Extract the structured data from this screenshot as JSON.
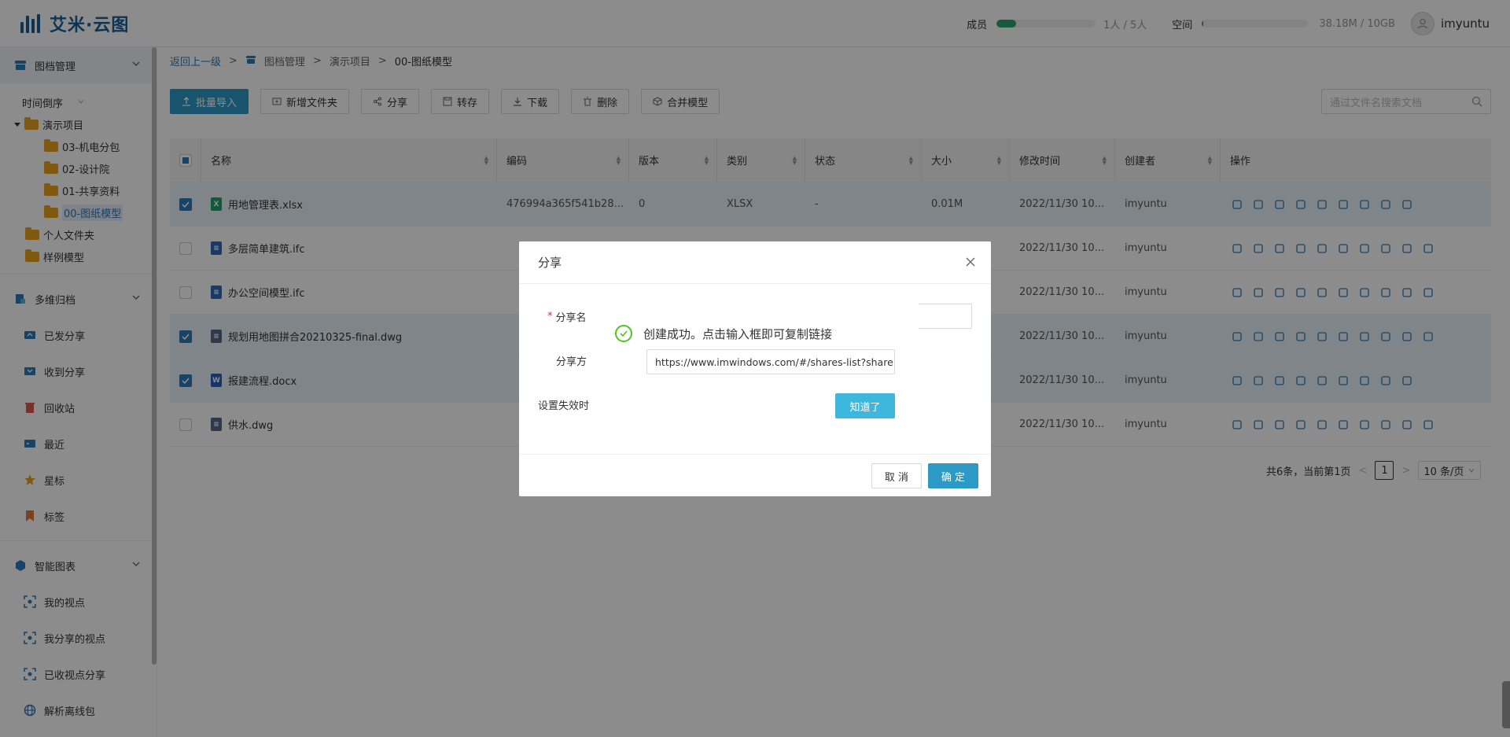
{
  "app": {
    "logo_text": "艾米·云图"
  },
  "header": {
    "members_label": "成员",
    "members_value": "1人 / 5人",
    "members_fraction": 0.2,
    "space_label": "空间",
    "space_value": "38.18M / 10GB",
    "space_fraction": 0.004,
    "username": "imyuntu"
  },
  "sidebar": {
    "section1": "图档管理",
    "sort_label": "时间倒序",
    "tree": [
      {
        "label": "演示项目"
      },
      {
        "label": "03-机电分包"
      },
      {
        "label": "02-设计院"
      },
      {
        "label": "01-共享资料"
      },
      {
        "label": "00-图纸模型"
      },
      {
        "label": "个人文件夹"
      },
      {
        "label": "样例模型"
      }
    ],
    "section2": "多维归档",
    "nav2": [
      {
        "label": "已发分享"
      },
      {
        "label": "收到分享"
      },
      {
        "label": "回收站"
      },
      {
        "label": "最近"
      },
      {
        "label": "星标"
      },
      {
        "label": "标签"
      }
    ],
    "section3": "智能图表",
    "nav3": [
      {
        "label": "我的视点"
      },
      {
        "label": "我分享的视点"
      },
      {
        "label": "已收视点分享"
      },
      {
        "label": "解析离线包"
      }
    ]
  },
  "breadcrumb": {
    "back": "返回上一级",
    "sep": ">",
    "root": "图档管理",
    "project": "演示项目",
    "current": "00-图纸模型"
  },
  "toolbar": {
    "import": "批量导入",
    "new_folder": "新增文件夹",
    "share": "分享",
    "transfer": "转存",
    "download": "下载",
    "delete": "删除",
    "merge": "合并模型",
    "search_placeholder": "通过文件名搜索文档"
  },
  "table": {
    "headers": [
      "名称",
      "编码",
      "版本",
      "类别",
      "状态",
      "大小",
      "修改时间",
      "创建者",
      "操作"
    ],
    "rows": [
      {
        "name": "用地管理表.xlsx",
        "code": "476994a365f541b28...",
        "version": "0",
        "type": "XLSX",
        "status": "-",
        "size": "0.01M",
        "time": "2022/11/30 10...",
        "creator": "imyuntu"
      },
      {
        "name": "多层简单建筑.ifc",
        "code": "",
        "version": "",
        "type": "",
        "status": "",
        "size": "",
        "time": "2022/11/30 10...",
        "creator": "imyuntu"
      },
      {
        "name": "办公空间模型.ifc",
        "code": "",
        "version": "",
        "type": "",
        "status": "",
        "size": "",
        "time": "2022/11/30 10...",
        "creator": "imyuntu"
      },
      {
        "name": "规划用地图拼合20210325-final.dwg",
        "code": "",
        "version": "",
        "type": "",
        "status": "",
        "size": "",
        "time": "2022/11/30 10...",
        "creator": "imyuntu"
      },
      {
        "name": "报建流程.docx",
        "code": "",
        "version": "",
        "type": "",
        "status": "",
        "size": "",
        "time": "2022/11/30 10...",
        "creator": "imyuntu"
      },
      {
        "name": "供水.dwg",
        "code": "",
        "version": "",
        "type": "",
        "status": "",
        "size": "",
        "time": "2022/11/30 10...",
        "creator": "imyuntu"
      }
    ]
  },
  "pagination": {
    "summary": "共6条，当前第1页",
    "prev": "<",
    "page": "1",
    "next": ">",
    "page_size": "10 条/页"
  },
  "share_dialog": {
    "title": "分享",
    "name_label": "分享名",
    "mode_label": "分享方",
    "expire_label": "设置失效时",
    "cancel": "取 消",
    "ok": "确 定"
  },
  "success_dialog": {
    "message": "创建成功。点击输入框即可复制链接",
    "link": "https://www.imwindows.com/#/shares-list?share",
    "button": "知道了"
  }
}
